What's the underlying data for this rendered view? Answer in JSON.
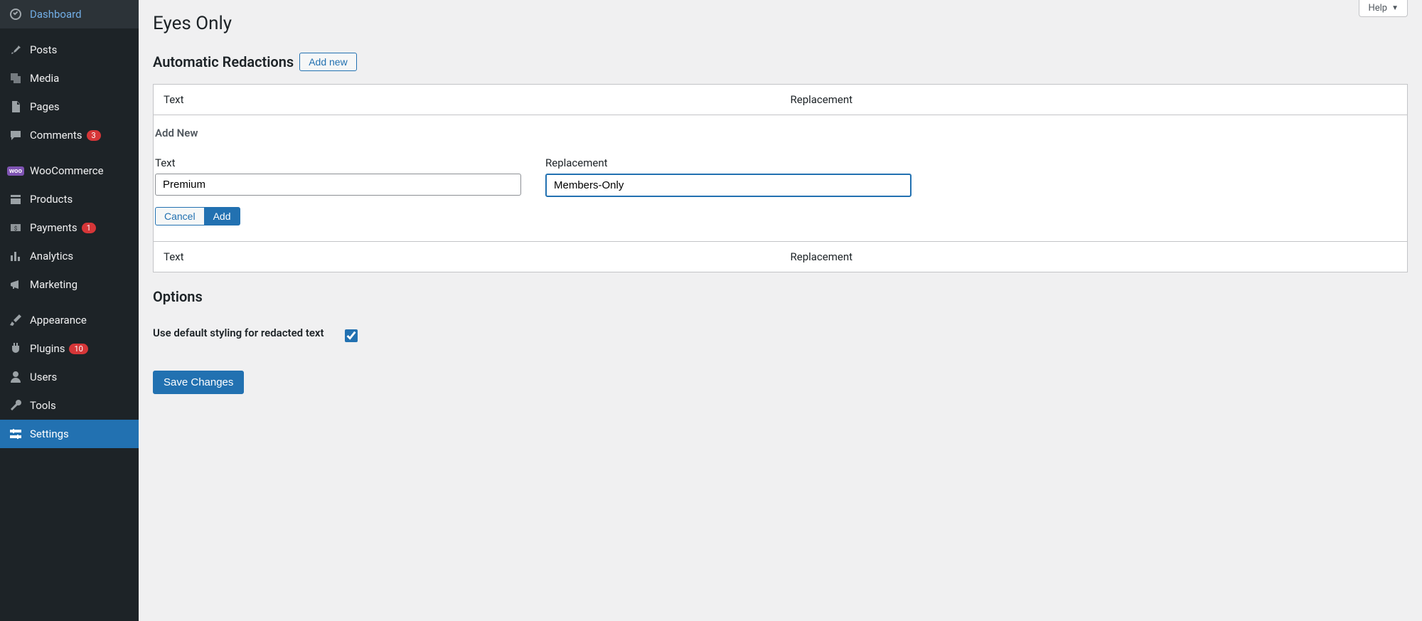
{
  "sidebar": {
    "items": [
      {
        "label": "Dashboard",
        "badge": null
      },
      {
        "label": "Posts",
        "badge": null
      },
      {
        "label": "Media",
        "badge": null
      },
      {
        "label": "Pages",
        "badge": null
      },
      {
        "label": "Comments",
        "badge": "3"
      },
      {
        "label": "WooCommerce",
        "badge": null
      },
      {
        "label": "Products",
        "badge": null
      },
      {
        "label": "Payments",
        "badge": "1"
      },
      {
        "label": "Analytics",
        "badge": null
      },
      {
        "label": "Marketing",
        "badge": null
      },
      {
        "label": "Appearance",
        "badge": null
      },
      {
        "label": "Plugins",
        "badge": "10"
      },
      {
        "label": "Users",
        "badge": null
      },
      {
        "label": "Tools",
        "badge": null
      },
      {
        "label": "Settings",
        "badge": null
      }
    ]
  },
  "help_label": "Help",
  "page_title": "Eyes Only",
  "redactions": {
    "heading": "Automatic Redactions",
    "add_new_btn": "Add new",
    "col_text": "Text",
    "col_replacement": "Replacement",
    "add_new_heading": "Add New",
    "text_label": "Text",
    "replacement_label": "Replacement",
    "text_value": "Premium",
    "replacement_value": "Members-Only",
    "cancel_label": "Cancel",
    "add_label": "Add"
  },
  "options": {
    "heading": "Options",
    "default_styling_label": "Use default styling for redacted text",
    "default_styling_checked": true
  },
  "save_label": "Save Changes"
}
